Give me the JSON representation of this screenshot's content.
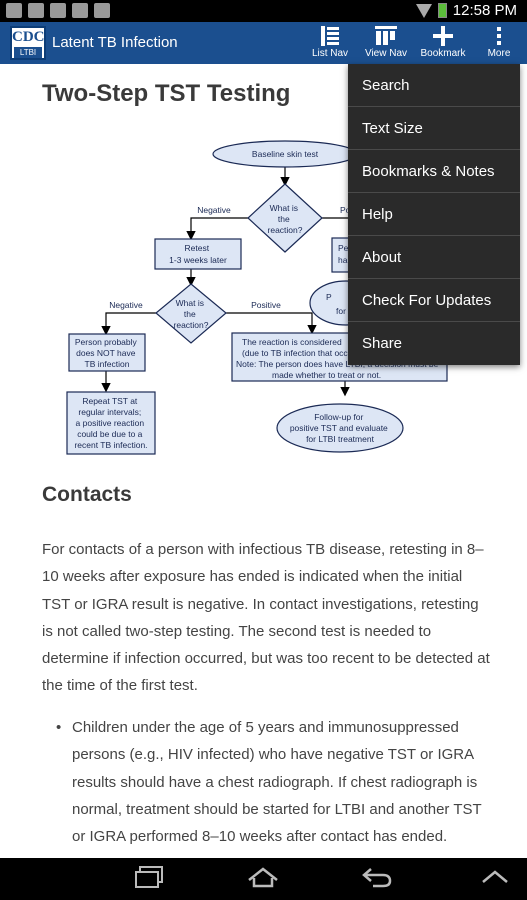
{
  "status_bar": {
    "time": "12:58 PM"
  },
  "app_bar": {
    "logo_text": "CDC",
    "logo_sub": "LTBI",
    "title": "Latent TB Infection",
    "actions": [
      {
        "label": "List Nav",
        "icon": "list-icon"
      },
      {
        "label": "View Nav",
        "icon": "view-nav-icon"
      },
      {
        "label": "Bookmark",
        "icon": "plus-icon"
      },
      {
        "label": "More",
        "icon": "overflow-icon"
      }
    ]
  },
  "content": {
    "heading": "Two-Step TST Testing",
    "flowchart": {
      "baseline": "Baseline skin test",
      "decision1": [
        "What is",
        "the",
        "reaction?"
      ],
      "neg1": "Negative",
      "pos1": "Po",
      "retest": [
        "Retest",
        "1-3 weeks later"
      ],
      "pos_box_partial": [
        "Pe",
        "ha"
      ],
      "decision2": [
        "What is",
        "the",
        "reaction?"
      ],
      "neg2": "Negative",
      "pos2": "Positive",
      "not_ltbi": [
        "Person probably",
        "does NOT have",
        "TB infection"
      ],
      "repeat": [
        "Repeat TST at",
        "regular intervals;",
        "a positive reaction",
        "could be due to a",
        "recent TB infection."
      ],
      "considered": [
        "The reaction is considered",
        "(due to TB infection that occ",
        "Note: The person does have LTBI; a decision must be",
        "made whether to treat or not."
      ],
      "ellipse_partial": [
        "P",
        "for"
      ],
      "followup": [
        "Follow-up for",
        "positive TST and evaluate",
        "for LTBI treatment"
      ]
    },
    "subheading": "Contacts",
    "paragraph": "For contacts of a person with infectious TB disease, retesting in 8–10 weeks after exposure has ended is indicated when the initial TST or IGRA result is negative. In contact investigations, retesting is not called two-step testing. The second test is needed to determine if infection occurred, but was too recent to be detected at the time of the first test.",
    "bullet": "Children under the age of 5 years and immunosuppressed persons (e.g., HIV infected) who have negative TST or IGRA results should have a chest radiograph. If chest radiograph is normal, treatment should be started for LTBI and another TST or IGRA performed 8–10 weeks after contact has ended."
  },
  "overflow_menu": [
    "Search",
    "Text Size",
    "Bookmarks & Notes",
    "Help",
    "About",
    "Check For Updates",
    "Share"
  ]
}
